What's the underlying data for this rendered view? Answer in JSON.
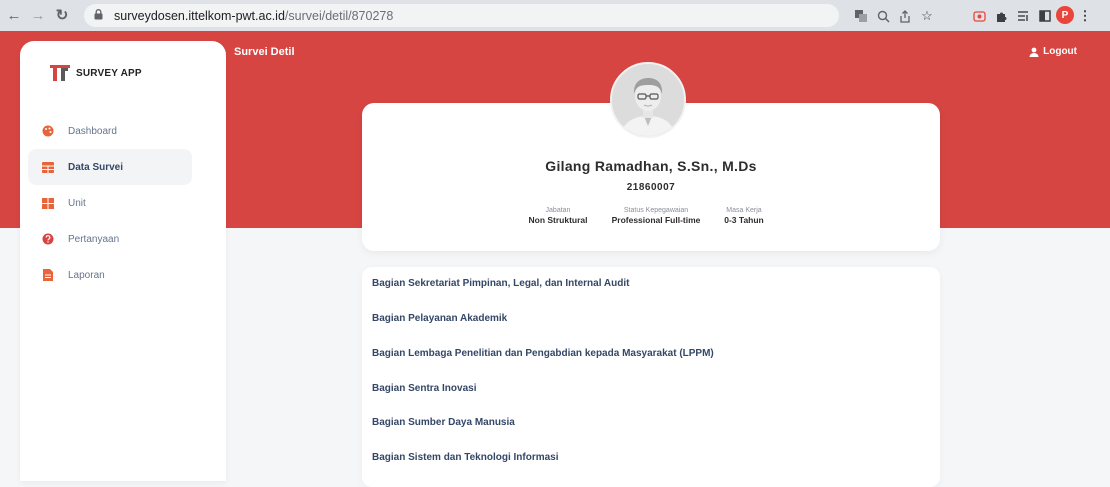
{
  "browser": {
    "url_host": "surveydosen.ittelkom-pwt.ac.id",
    "url_path": "/survei/detil/870278",
    "profile_initial": "P"
  },
  "brand": {
    "name": "SURVEY APP"
  },
  "sidebar": {
    "items": [
      {
        "label": "Dashboard",
        "icon": "palette-icon",
        "color": "#e8643b",
        "active": false
      },
      {
        "label": "Data Survei",
        "icon": "table-icon",
        "color": "#e8643b",
        "active": true
      },
      {
        "label": "Unit",
        "icon": "grid-icon",
        "color": "#e8643b",
        "active": false
      },
      {
        "label": "Pertanyaan",
        "icon": "question-icon",
        "color": "#d64541",
        "active": false
      },
      {
        "label": "Laporan",
        "icon": "file-icon",
        "color": "#e8643b",
        "active": false
      }
    ]
  },
  "header": {
    "title": "Survei Detil",
    "logout_label": "Logout"
  },
  "profile": {
    "name": "Gilang Ramadhan, S.Sn., M.Ds",
    "nip": "21860007",
    "meta": [
      {
        "label": "Jabatan",
        "value": "Non Struktural"
      },
      {
        "label": "Status Kepegawaian",
        "value": "Professional Full-time"
      },
      {
        "label": "Masa Kerja",
        "value": "0-3 Tahun"
      }
    ]
  },
  "units": [
    "Bagian Sekretariat Pimpinan, Legal, dan Internal Audit",
    "Bagian Pelayanan Akademik",
    "Bagian Lembaga Penelitian dan Pengabdian kepada Masyarakat (LPPM)",
    "Bagian Sentra Inovasi",
    "Bagian Sumber Daya Manusia",
    "Bagian Sistem dan Teknologi Informasi"
  ],
  "colors": {
    "primary": "#d64541",
    "accent": "#e8643b",
    "text": "#344767"
  }
}
